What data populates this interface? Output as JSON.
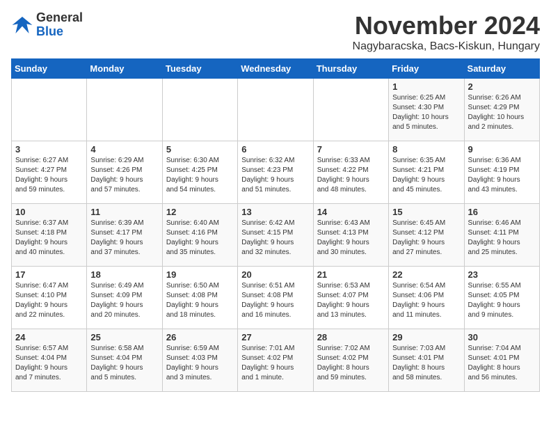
{
  "header": {
    "logo_line1": "General",
    "logo_line2": "Blue",
    "month_title": "November 2024",
    "location": "Nagybaracska, Bacs-Kiskun, Hungary"
  },
  "days_of_week": [
    "Sunday",
    "Monday",
    "Tuesday",
    "Wednesday",
    "Thursday",
    "Friday",
    "Saturday"
  ],
  "weeks": [
    [
      {
        "day": "",
        "info": ""
      },
      {
        "day": "",
        "info": ""
      },
      {
        "day": "",
        "info": ""
      },
      {
        "day": "",
        "info": ""
      },
      {
        "day": "",
        "info": ""
      },
      {
        "day": "1",
        "info": "Sunrise: 6:25 AM\nSunset: 4:30 PM\nDaylight: 10 hours\nand 5 minutes."
      },
      {
        "day": "2",
        "info": "Sunrise: 6:26 AM\nSunset: 4:29 PM\nDaylight: 10 hours\nand 2 minutes."
      }
    ],
    [
      {
        "day": "3",
        "info": "Sunrise: 6:27 AM\nSunset: 4:27 PM\nDaylight: 9 hours\nand 59 minutes."
      },
      {
        "day": "4",
        "info": "Sunrise: 6:29 AM\nSunset: 4:26 PM\nDaylight: 9 hours\nand 57 minutes."
      },
      {
        "day": "5",
        "info": "Sunrise: 6:30 AM\nSunset: 4:25 PM\nDaylight: 9 hours\nand 54 minutes."
      },
      {
        "day": "6",
        "info": "Sunrise: 6:32 AM\nSunset: 4:23 PM\nDaylight: 9 hours\nand 51 minutes."
      },
      {
        "day": "7",
        "info": "Sunrise: 6:33 AM\nSunset: 4:22 PM\nDaylight: 9 hours\nand 48 minutes."
      },
      {
        "day": "8",
        "info": "Sunrise: 6:35 AM\nSunset: 4:21 PM\nDaylight: 9 hours\nand 45 minutes."
      },
      {
        "day": "9",
        "info": "Sunrise: 6:36 AM\nSunset: 4:19 PM\nDaylight: 9 hours\nand 43 minutes."
      }
    ],
    [
      {
        "day": "10",
        "info": "Sunrise: 6:37 AM\nSunset: 4:18 PM\nDaylight: 9 hours\nand 40 minutes."
      },
      {
        "day": "11",
        "info": "Sunrise: 6:39 AM\nSunset: 4:17 PM\nDaylight: 9 hours\nand 37 minutes."
      },
      {
        "day": "12",
        "info": "Sunrise: 6:40 AM\nSunset: 4:16 PM\nDaylight: 9 hours\nand 35 minutes."
      },
      {
        "day": "13",
        "info": "Sunrise: 6:42 AM\nSunset: 4:15 PM\nDaylight: 9 hours\nand 32 minutes."
      },
      {
        "day": "14",
        "info": "Sunrise: 6:43 AM\nSunset: 4:13 PM\nDaylight: 9 hours\nand 30 minutes."
      },
      {
        "day": "15",
        "info": "Sunrise: 6:45 AM\nSunset: 4:12 PM\nDaylight: 9 hours\nand 27 minutes."
      },
      {
        "day": "16",
        "info": "Sunrise: 6:46 AM\nSunset: 4:11 PM\nDaylight: 9 hours\nand 25 minutes."
      }
    ],
    [
      {
        "day": "17",
        "info": "Sunrise: 6:47 AM\nSunset: 4:10 PM\nDaylight: 9 hours\nand 22 minutes."
      },
      {
        "day": "18",
        "info": "Sunrise: 6:49 AM\nSunset: 4:09 PM\nDaylight: 9 hours\nand 20 minutes."
      },
      {
        "day": "19",
        "info": "Sunrise: 6:50 AM\nSunset: 4:08 PM\nDaylight: 9 hours\nand 18 minutes."
      },
      {
        "day": "20",
        "info": "Sunrise: 6:51 AM\nSunset: 4:08 PM\nDaylight: 9 hours\nand 16 minutes."
      },
      {
        "day": "21",
        "info": "Sunrise: 6:53 AM\nSunset: 4:07 PM\nDaylight: 9 hours\nand 13 minutes."
      },
      {
        "day": "22",
        "info": "Sunrise: 6:54 AM\nSunset: 4:06 PM\nDaylight: 9 hours\nand 11 minutes."
      },
      {
        "day": "23",
        "info": "Sunrise: 6:55 AM\nSunset: 4:05 PM\nDaylight: 9 hours\nand 9 minutes."
      }
    ],
    [
      {
        "day": "24",
        "info": "Sunrise: 6:57 AM\nSunset: 4:04 PM\nDaylight: 9 hours\nand 7 minutes."
      },
      {
        "day": "25",
        "info": "Sunrise: 6:58 AM\nSunset: 4:04 PM\nDaylight: 9 hours\nand 5 minutes."
      },
      {
        "day": "26",
        "info": "Sunrise: 6:59 AM\nSunset: 4:03 PM\nDaylight: 9 hours\nand 3 minutes."
      },
      {
        "day": "27",
        "info": "Sunrise: 7:01 AM\nSunset: 4:02 PM\nDaylight: 9 hours\nand 1 minute."
      },
      {
        "day": "28",
        "info": "Sunrise: 7:02 AM\nSunset: 4:02 PM\nDaylight: 8 hours\nand 59 minutes."
      },
      {
        "day": "29",
        "info": "Sunrise: 7:03 AM\nSunset: 4:01 PM\nDaylight: 8 hours\nand 58 minutes."
      },
      {
        "day": "30",
        "info": "Sunrise: 7:04 AM\nSunset: 4:01 PM\nDaylight: 8 hours\nand 56 minutes."
      }
    ]
  ]
}
